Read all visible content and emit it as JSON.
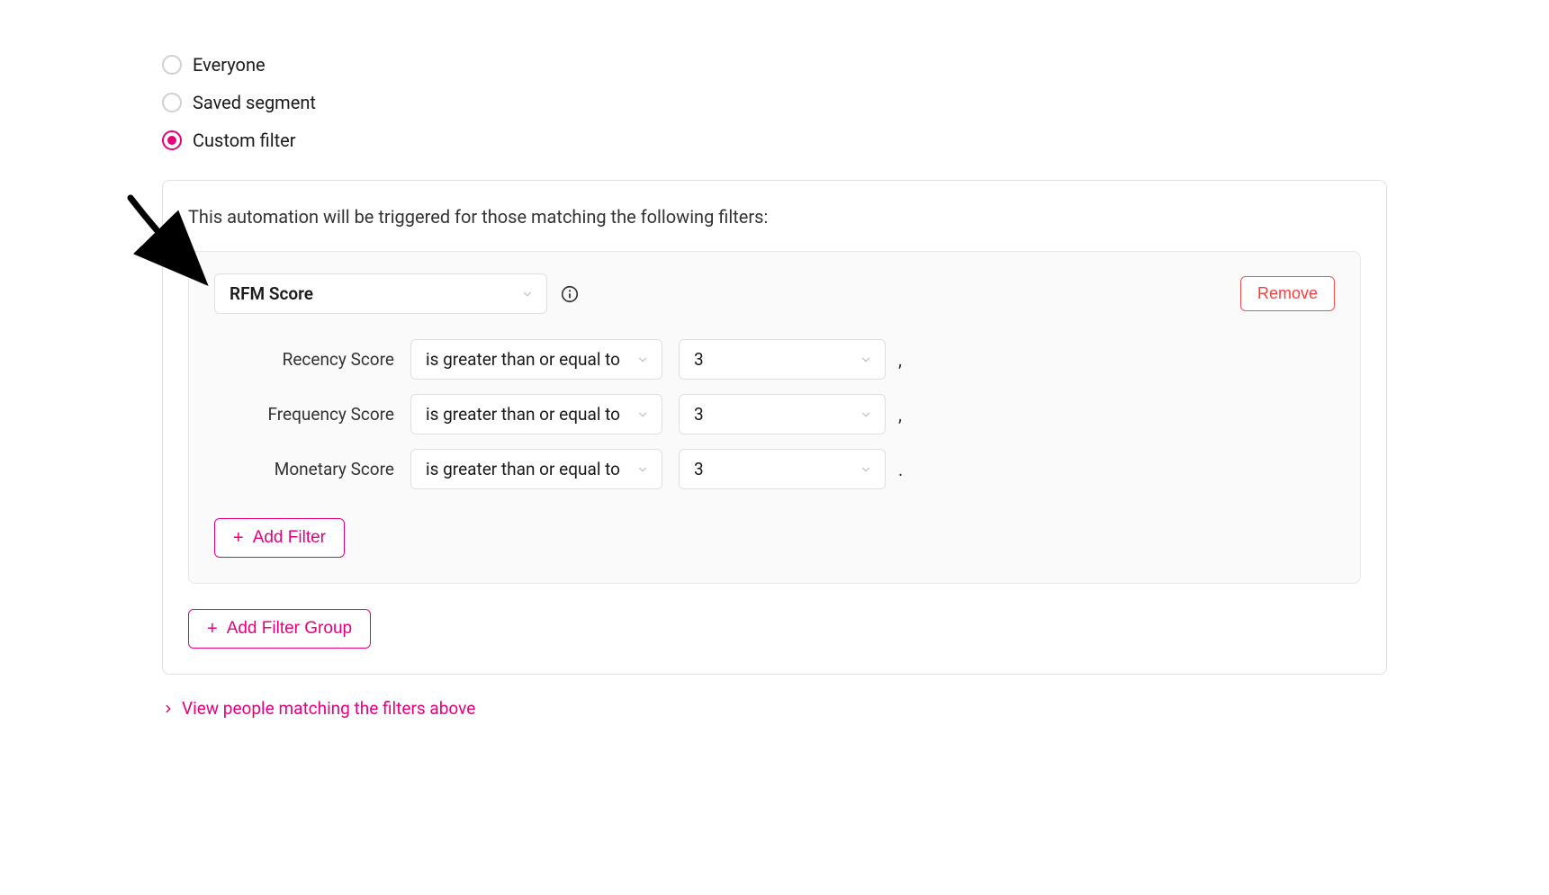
{
  "radio_options": {
    "everyone": "Everyone",
    "saved_segment": "Saved segment",
    "custom_filter": "Custom filter",
    "selected": "custom_filter"
  },
  "filter_panel": {
    "description": "This automation will be triggered for those matching the following filters:",
    "group": {
      "filter_type": "RFM Score",
      "remove_label": "Remove",
      "rows": [
        {
          "label": "Recency Score",
          "operator": "is greater than or equal to",
          "value": "3",
          "suffix": ","
        },
        {
          "label": "Frequency Score",
          "operator": "is greater than or equal to",
          "value": "3",
          "suffix": ","
        },
        {
          "label": "Monetary Score",
          "operator": "is greater than or equal to",
          "value": "3",
          "suffix": "."
        }
      ],
      "add_filter_label": "Add Filter"
    },
    "add_filter_group_label": "Add Filter Group"
  },
  "view_link": "View people matching the filters above",
  "colors": {
    "accent": "#e6007e",
    "danger": "#ff3b3b"
  }
}
